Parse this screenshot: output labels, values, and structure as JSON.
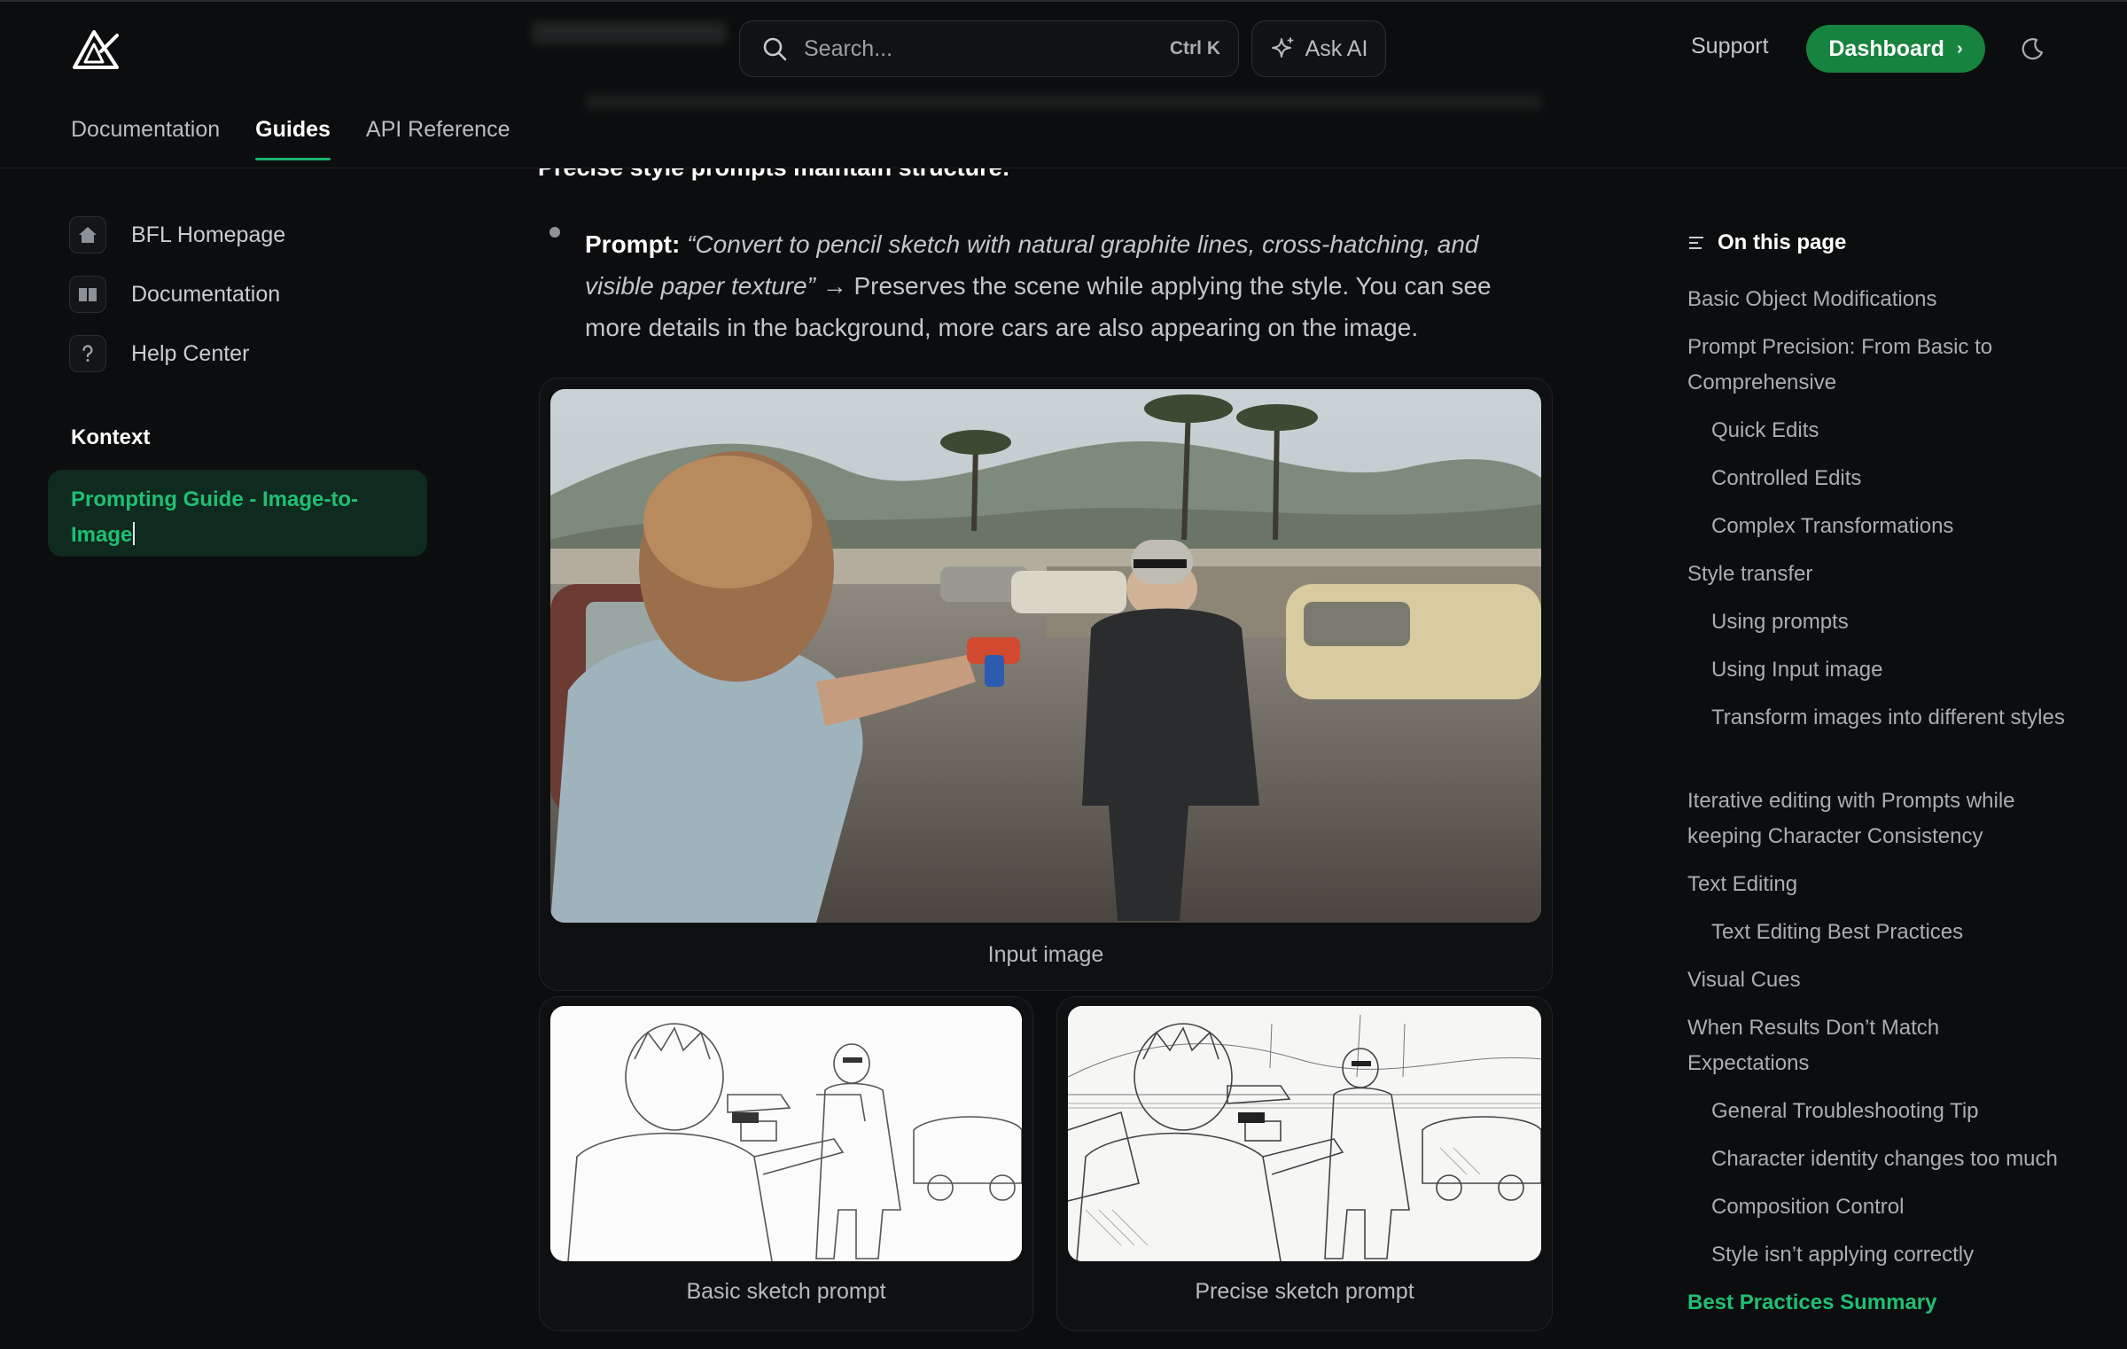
{
  "header": {
    "search_placeholder": "Search...",
    "search_shortcut": "Ctrl K",
    "ask_ai_label": "Ask AI",
    "support_label": "Support",
    "dashboard_label": "Dashboard",
    "tabs": [
      {
        "label": "Documentation",
        "active": false
      },
      {
        "label": "Guides",
        "active": true
      },
      {
        "label": "API Reference",
        "active": false
      }
    ]
  },
  "sidebar": {
    "links": [
      {
        "label": "BFL Homepage",
        "icon": "home-icon"
      },
      {
        "label": "Documentation",
        "icon": "book-icon"
      },
      {
        "label": "Help Center",
        "icon": "question-icon"
      }
    ],
    "section_title": "Kontext",
    "active_item": "Prompting Guide - Image-to-Image"
  },
  "main": {
    "subheading": "Precise style prompts maintain structure:",
    "bullet": {
      "label": "Prompt:",
      "quote": "“Convert to pencil sketch with natural graphite lines, cross-hatching, and visible paper texture”",
      "arrow": "→",
      "text": "Preserves the scene while applying the style. You can see more details in the background, more cars are also appearing on the image."
    },
    "captions": {
      "input": "Input image",
      "basic": "Basic sketch prompt",
      "precise": "Precise sketch prompt"
    }
  },
  "toc": {
    "title": "On this page",
    "items": [
      {
        "label": "Basic Object Modifications",
        "level": 1
      },
      {
        "label": "Prompt Precision: From Basic to Comprehensive",
        "level": 1
      },
      {
        "label": "Quick Edits",
        "level": 2
      },
      {
        "label": "Controlled Edits",
        "level": 2
      },
      {
        "label": "Complex Transformations",
        "level": 2
      },
      {
        "label": "Style transfer",
        "level": 1
      },
      {
        "label": "Using prompts",
        "level": 2
      },
      {
        "label": "Using Input image",
        "level": 2
      },
      {
        "label": "Transform images into different styles",
        "level": 2
      },
      {
        "label": "Iterative editing with Prompts while keeping Character Consistency",
        "level": 1
      },
      {
        "label": "Text Editing",
        "level": 1
      },
      {
        "label": "Text Editing Best Practices",
        "level": 2
      },
      {
        "label": "Visual Cues",
        "level": 1
      },
      {
        "label": "When Results Don’t Match Expectations",
        "level": 1
      },
      {
        "label": "General Troubleshooting Tip",
        "level": 2
      },
      {
        "label": "Character identity changes too much",
        "level": 2
      },
      {
        "label": "Composition Control",
        "level": 2
      },
      {
        "label": "Style isn’t applying correctly",
        "level": 2
      },
      {
        "label": "Best Practices Summary",
        "level": 1,
        "active": true
      }
    ]
  },
  "colors": {
    "background": "#0b0d0e",
    "accent_green": "#17b26a",
    "dashboard_button": "#16833e",
    "active_bg": "#0f2a1e"
  }
}
